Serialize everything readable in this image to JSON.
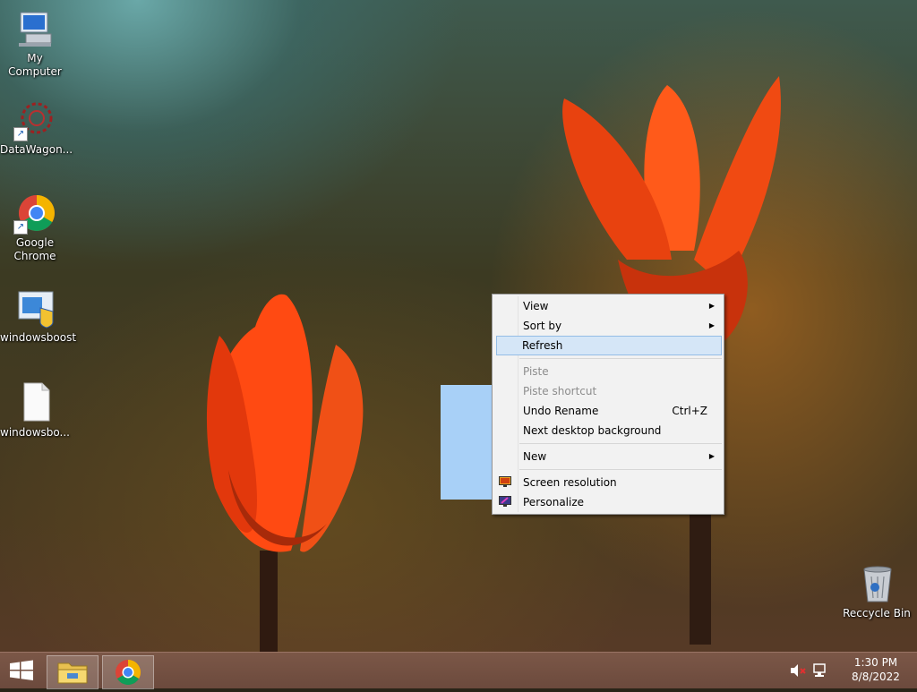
{
  "desktop": {
    "icons": [
      {
        "label": "My Computer",
        "icon": "computer-icon"
      },
      {
        "label": "DataWagon...",
        "icon": "datawagon-icon"
      },
      {
        "label": "Google Chrome",
        "icon": "chrome-icon"
      },
      {
        "label": "windowsboost",
        "icon": "installer-icon"
      },
      {
        "label": "windowsbo...",
        "icon": "file-icon"
      }
    ],
    "recycle_bin": {
      "label": "Reccycle Bin",
      "icon": "recycle-bin-icon"
    }
  },
  "context_menu": {
    "items": [
      {
        "label": "View",
        "submenu": true,
        "disabled": false
      },
      {
        "label": "Sort by",
        "submenu": true,
        "disabled": false
      },
      {
        "label": "Refresh",
        "submenu": false,
        "disabled": false,
        "highlighted": true
      },
      {
        "label": "Piste",
        "submenu": false,
        "disabled": true
      },
      {
        "label": "Piste shortcut",
        "submenu": false,
        "disabled": true
      },
      {
        "label": "Undo Rename",
        "shortcut": "Ctrl+Z",
        "disabled": false
      },
      {
        "label": "Next desktop background",
        "disabled": false
      },
      {
        "label": "New",
        "submenu": true,
        "disabled": false
      },
      {
        "label": "Screen resolution",
        "icon": "screen-resolution-icon",
        "disabled": false
      },
      {
        "label": "Personalize",
        "icon": "personalize-icon",
        "disabled": false
      }
    ]
  },
  "taskbar": {
    "start_icon": "windows-logo-icon",
    "pinned": [
      {
        "name": "File Explorer",
        "icon": "file-explorer-icon"
      },
      {
        "name": "Google Chrome",
        "icon": "chrome-icon"
      }
    ],
    "tray": {
      "volume_icon": "volume-muted-icon",
      "network_icon": "network-icon",
      "time": "1:30 PM",
      "date": "8/8/2022"
    }
  },
  "colors": {
    "taskbar": "#6c4a3d",
    "menu_bg": "#f2f2f2",
    "menu_highlight": "#d5e6f7",
    "disabled_text": "#8d8d8d"
  }
}
